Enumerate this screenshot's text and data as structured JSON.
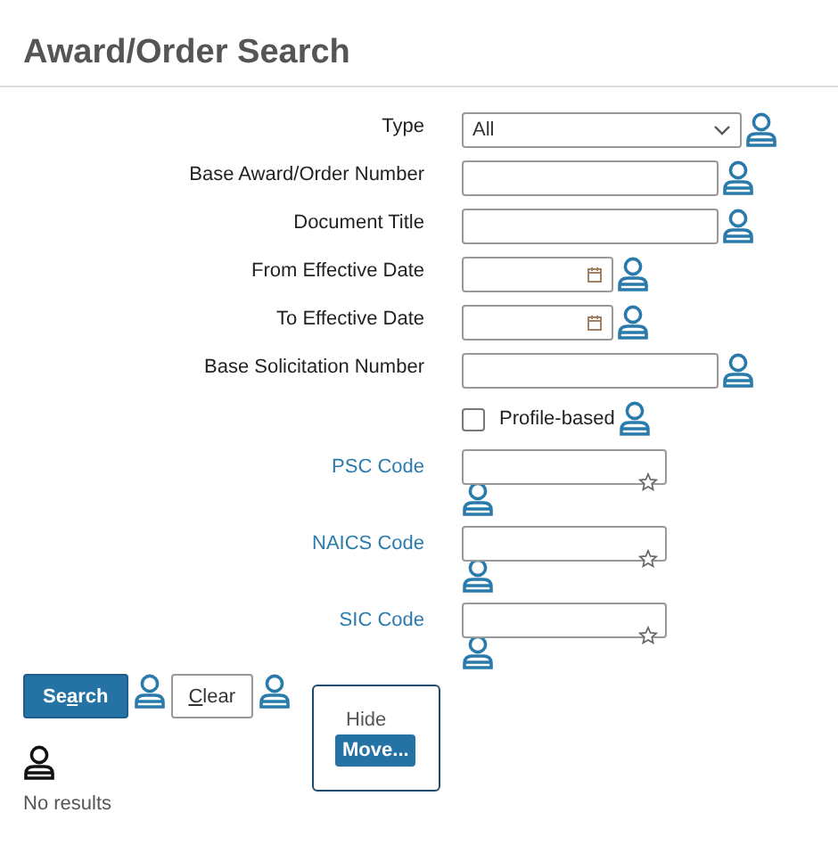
{
  "page": {
    "title": "Award/Order Search"
  },
  "fields": [
    {
      "kind": "select",
      "label": "Type",
      "value": "All"
    },
    {
      "kind": "text",
      "label": "Base Award/Order Number"
    },
    {
      "kind": "text",
      "label": "Document Title"
    },
    {
      "kind": "date",
      "label": "From Effective Date"
    },
    {
      "kind": "date",
      "label": "To Effective Date"
    },
    {
      "kind": "text",
      "label": "Base Solicitation Number"
    },
    {
      "kind": "checkbox",
      "label": "Profile-based",
      "checked": false
    },
    {
      "kind": "lookup",
      "label": "PSC Code"
    },
    {
      "kind": "lookup",
      "label": "NAICS Code"
    },
    {
      "kind": "lookup",
      "label": "SIC Code"
    }
  ],
  "buttons": [
    {
      "kind": "primary",
      "label_start": "Se",
      "access_key": "a",
      "label_end": "rch"
    },
    {
      "kind": "secondary",
      "access_key": "C",
      "label_end": "lear"
    }
  ],
  "panel": {
    "label": "Hide",
    "button": "Move..."
  },
  "status": "No results"
}
